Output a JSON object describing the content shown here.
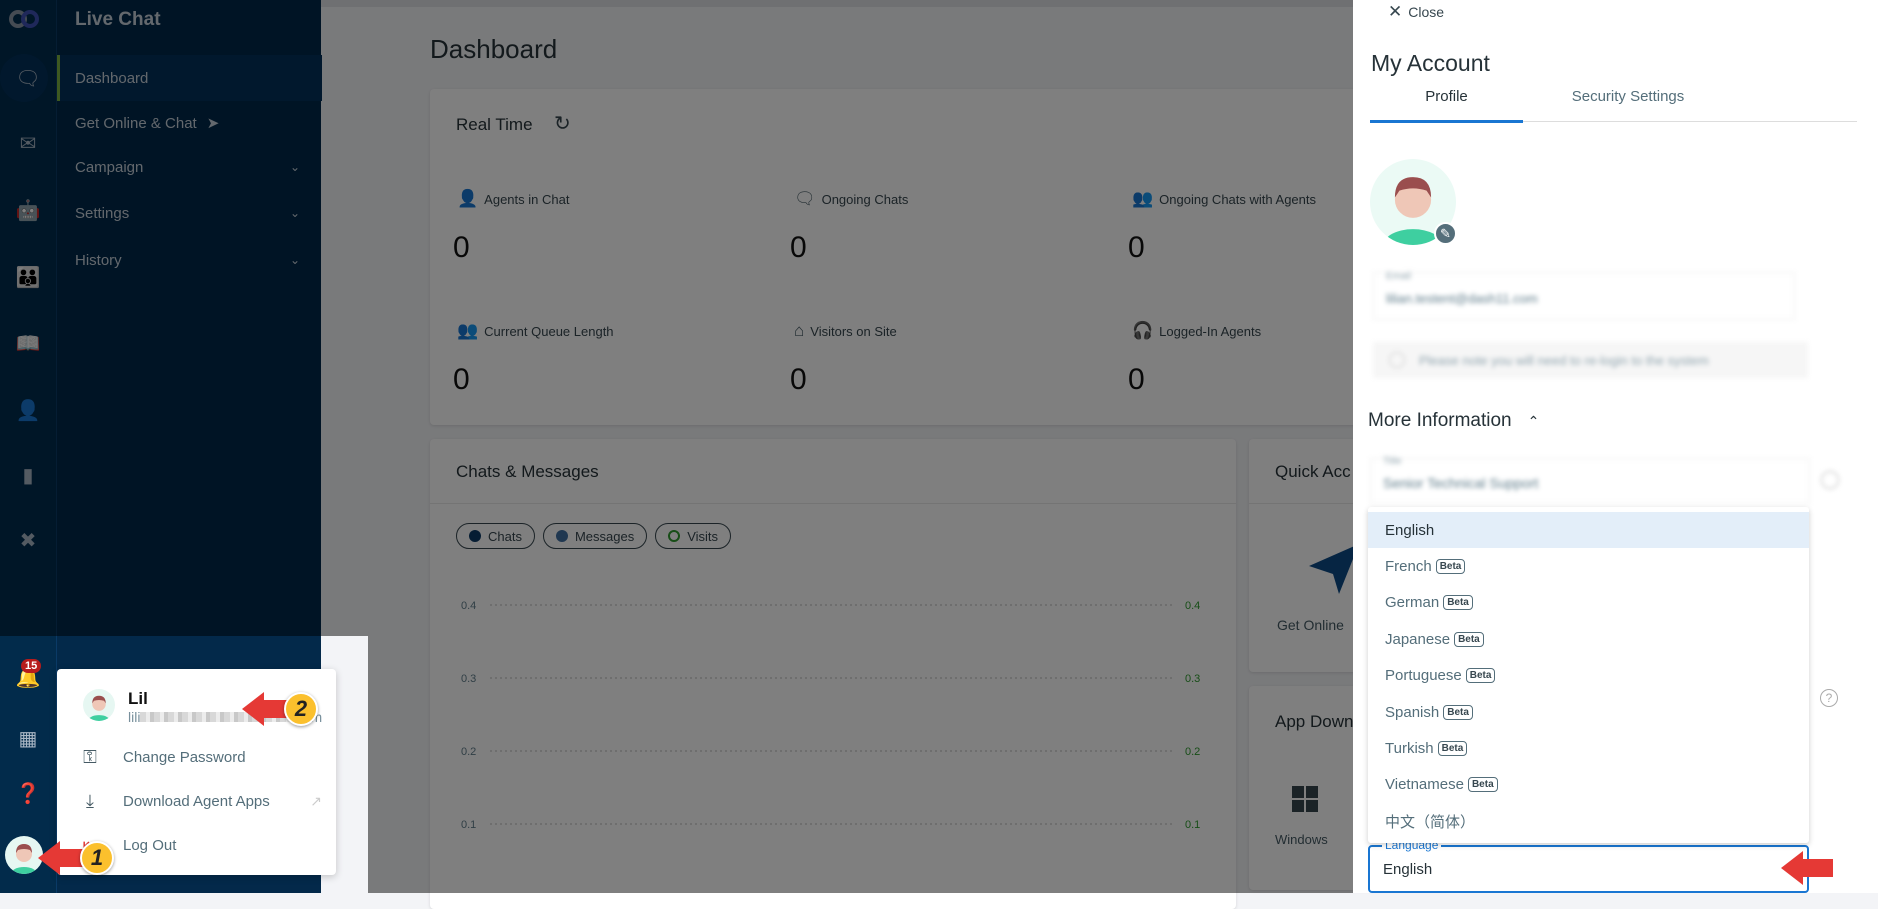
{
  "sidebar": {
    "app_title": "Live Chat",
    "items": [
      {
        "label": "Dashboard",
        "active": true
      },
      {
        "label": "Get Online & Chat",
        "icon": "paper-plane-icon"
      },
      {
        "label": "Campaign",
        "expandable": true
      },
      {
        "label": "Settings",
        "expandable": true
      },
      {
        "label": "History",
        "expandable": true
      }
    ],
    "rail_icons": [
      "chat-icon",
      "messages-icon",
      "bot-icon",
      "team-icon",
      "knowledge-book-icon",
      "contact-list-icon",
      "reports-icon",
      "tools-icon"
    ],
    "notification_count": "15",
    "accent": "#7cb342"
  },
  "user_menu": {
    "name": "Lil",
    "email_start": "lili",
    "email_end": "m",
    "items": [
      {
        "label": "Change Password",
        "icon": "key-icon"
      },
      {
        "label": "Download Agent Apps",
        "icon": "download-icon",
        "external": true
      },
      {
        "label": "Log Out",
        "icon": "logout-icon"
      }
    ]
  },
  "annotations": {
    "step1": "1",
    "step2": "2",
    "arrow_color": "#e53935",
    "badge_color": "#fbc02d"
  },
  "dashboard": {
    "title": "Dashboard",
    "realtime": {
      "title": "Real Time",
      "stats": [
        {
          "label": "Agents in Chat",
          "value": "0",
          "icon": "agent-icon"
        },
        {
          "label": "Ongoing Chats",
          "value": "0",
          "icon": "chat-bubble-icon"
        },
        {
          "label": "Ongoing Chats with Agents",
          "value": "0",
          "icon": "chat-agent-icon"
        },
        {
          "label": "Current Queue Length",
          "value": "0",
          "icon": "queue-icon"
        },
        {
          "label": "Visitors on Site",
          "value": "0",
          "icon": "home-icon"
        },
        {
          "label": "Logged-In Agents",
          "value": "0",
          "icon": "headset-icon"
        }
      ]
    },
    "chats_messages": {
      "title": "Chats & Messages"
    },
    "quick_access": {
      "title": "Quick Acc",
      "item": "Get Online"
    },
    "app_downloads": {
      "title": "App Down",
      "item": "Windows"
    }
  },
  "chart_data": {
    "type": "line",
    "series": [
      {
        "name": "Chats",
        "color": "#0d3b66",
        "values": []
      },
      {
        "name": "Messages",
        "color": "#3f6fa0",
        "values": []
      },
      {
        "name": "Visits",
        "color": "#2e9b2e",
        "values": []
      }
    ],
    "y_left_ticks": [
      "0.4",
      "0.3",
      "0.2",
      "0.1"
    ],
    "y_right_ticks": [
      "0.4",
      "0.3",
      "0.2",
      "0.1"
    ],
    "y_right_color": "#2e9b2e",
    "grid": true
  },
  "drawer": {
    "close_label": "Close",
    "title": "My Account",
    "tabs": [
      {
        "label": "Profile",
        "active": true
      },
      {
        "label": "Security Settings"
      }
    ],
    "email_label": "Email",
    "email_value": "lilian.testent@dash11.com",
    "relogin_note": "Please note you will need to re-login to the system",
    "more_info": "More Information",
    "title_label": "Title",
    "title_value": "Senior Technical Support",
    "language_label": "Language",
    "language_value": "English",
    "beta_label": "Beta",
    "languages": [
      {
        "label": "English",
        "selected": true
      },
      {
        "label": "French",
        "beta": true
      },
      {
        "label": "German",
        "beta": true
      },
      {
        "label": "Japanese",
        "beta": true
      },
      {
        "label": "Portuguese",
        "beta": true
      },
      {
        "label": "Spanish",
        "beta": true
      },
      {
        "label": "Turkish",
        "beta": true
      },
      {
        "label": "Vietnamese",
        "beta": true
      },
      {
        "label": "中文（简体）"
      }
    ],
    "accent": "#1976d2"
  }
}
